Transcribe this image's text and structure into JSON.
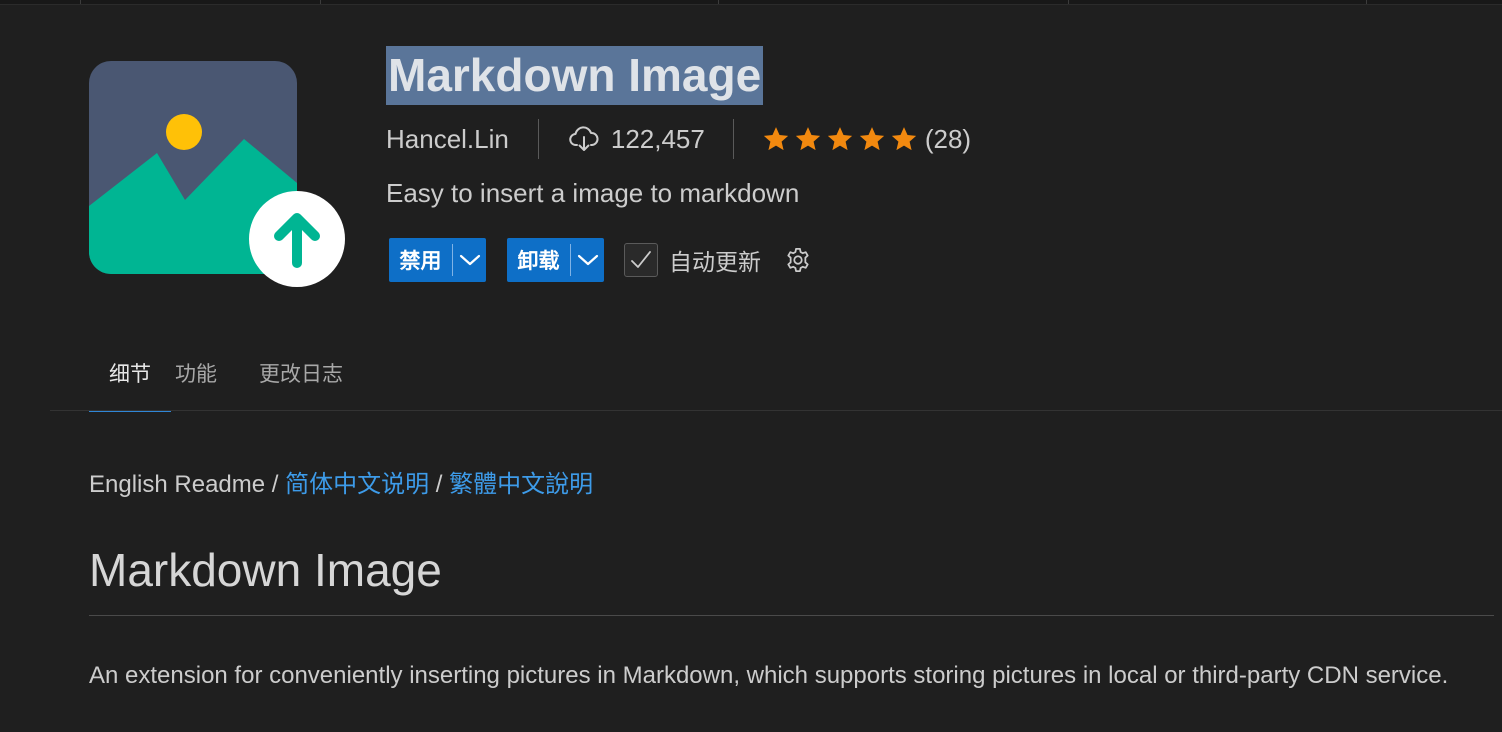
{
  "header": {
    "title": "Markdown Image",
    "publisher": "Hancel.Lin",
    "downloads": "122,457",
    "rating_stars": 5,
    "rating_count": "(28)",
    "description": "Easy to insert a image to markdown"
  },
  "actions": {
    "disable_label": "禁用",
    "uninstall_label": "卸载",
    "auto_update_label": "自动更新",
    "auto_update_checked": true
  },
  "tabs": [
    {
      "label": "细节",
      "active": true
    },
    {
      "label": "功能",
      "active": false
    },
    {
      "label": "更改日志",
      "active": false
    }
  ],
  "readme": {
    "lang_current": "English Readme",
    "sep": "/",
    "lang_zh_cn": "简体中文说明",
    "lang_zh_tw": "繁體中文說明",
    "heading": "Markdown Image",
    "paragraph": "An extension for conveniently inserting pictures in Markdown, which supports storing pictures in local or third-party CDN service."
  },
  "colors": {
    "background": "#1f1f1f",
    "accent_button": "#0e6fc7",
    "link": "#3d9be9",
    "star": "#f2890f",
    "title_highlight": "#5a7599",
    "icon_bg": "#4a5772",
    "icon_mountain": "#00b593",
    "icon_sun": "#ffc107"
  },
  "icons": {
    "extension_icon": "image-upload-icon",
    "downloads": "cloud-download-icon",
    "rating": "star-icon",
    "dropdown": "chevron-down-icon",
    "checkbox": "check-icon",
    "settings": "gear-icon"
  }
}
